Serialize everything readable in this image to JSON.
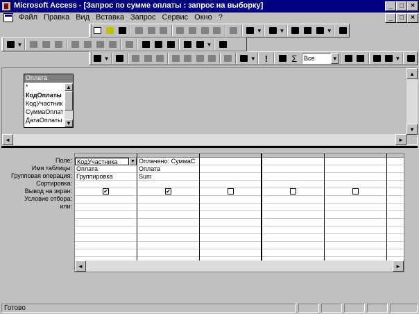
{
  "window": {
    "title": "Microsoft Access - [Запрос по сумме оплаты : запрос на выборку]",
    "minimize": "_",
    "maximize": "□",
    "close": "×",
    "doc_minimize": "_",
    "doc_restore": "□",
    "doc_close": "×"
  },
  "menu": {
    "items": [
      "Файл",
      "Правка",
      "Вид",
      "Вставка",
      "Запрос",
      "Сервис",
      "Окно",
      "?"
    ]
  },
  "toolbar3": {
    "totals_symbol": "Σ",
    "run_symbol": "!",
    "top_values": "Все"
  },
  "field_list": {
    "title": "Оплата",
    "items": [
      "*",
      "КодОплаты",
      "КодУчастник",
      "СуммаОплать",
      "ДатаОплаты"
    ],
    "primary_key": "КодОплаты"
  },
  "grid": {
    "row_labels": [
      "Поле:",
      "Имя таблицы:",
      "Групповая операция:",
      "Сортировка:",
      "Вывод на экран:",
      "Условие отбора:",
      "или:"
    ],
    "columns": [
      {
        "field": "КодУчастника",
        "table": "Оплата",
        "total": "Группировка",
        "sort": "",
        "show": true,
        "criteria": "",
        "or": ""
      },
      {
        "field": "Оплачено: СуммаС",
        "table": "Оплата",
        "total": "Sum",
        "sort": "",
        "show": true,
        "criteria": "",
        "or": ""
      },
      {
        "field": "",
        "table": "",
        "total": "",
        "sort": "",
        "show": false,
        "criteria": "",
        "or": ""
      },
      {
        "field": "",
        "table": "",
        "total": "",
        "sort": "",
        "show": false,
        "criteria": "",
        "or": ""
      },
      {
        "field": "",
        "table": "",
        "total": "",
        "sort": "",
        "show": false,
        "criteria": "",
        "or": ""
      }
    ],
    "check_mark": "✔"
  },
  "status": {
    "text": "Готово"
  },
  "colors": {
    "titlebar": "#000080",
    "face": "#c0c0c0"
  }
}
